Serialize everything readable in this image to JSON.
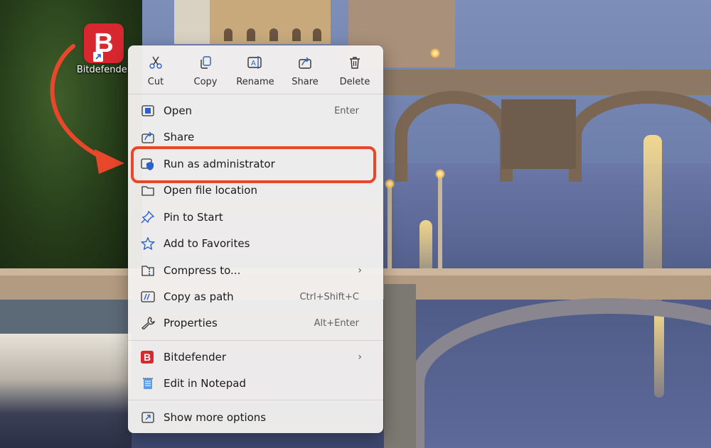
{
  "desktop": {
    "shortcut_label": "Bitdefender",
    "shortcut_letter": "B"
  },
  "context_menu": {
    "quick_actions": [
      {
        "label": "Cut",
        "icon": "scissors-icon"
      },
      {
        "label": "Copy",
        "icon": "copy-icon"
      },
      {
        "label": "Rename",
        "icon": "rename-icon"
      },
      {
        "label": "Share",
        "icon": "share-icon"
      },
      {
        "label": "Delete",
        "icon": "trash-icon"
      }
    ],
    "items": [
      {
        "label": "Open",
        "shortcut": "Enter",
        "icon": "open-icon"
      },
      {
        "label": "Share",
        "icon": "share-icon"
      },
      {
        "label": "Run as administrator",
        "icon": "admin-shield-icon",
        "highlighted": true
      },
      {
        "label": "Open file location",
        "icon": "folder-icon"
      },
      {
        "label": "Pin to Start",
        "icon": "pin-icon"
      },
      {
        "label": "Add to Favorites",
        "icon": "star-icon"
      },
      {
        "label": "Compress to...",
        "icon": "zip-folder-icon",
        "submenu": "›"
      },
      {
        "label": "Copy as path",
        "shortcut": "Ctrl+Shift+C",
        "icon": "path-icon"
      },
      {
        "label": "Properties",
        "shortcut": "Alt+Enter",
        "icon": "wrench-icon"
      },
      {
        "label": "Bitdefender",
        "icon": "bitdefender-icon",
        "submenu": "›",
        "icon_letter": "B"
      },
      {
        "label": "Edit in Notepad",
        "icon": "notepad-icon"
      },
      {
        "label": "Show more options",
        "icon": "more-options-icon"
      }
    ]
  },
  "colors": {
    "accent_blue": "#2b62c9",
    "highlight_outline": "#e8472b",
    "bitdefender_red": "#d7282f"
  }
}
